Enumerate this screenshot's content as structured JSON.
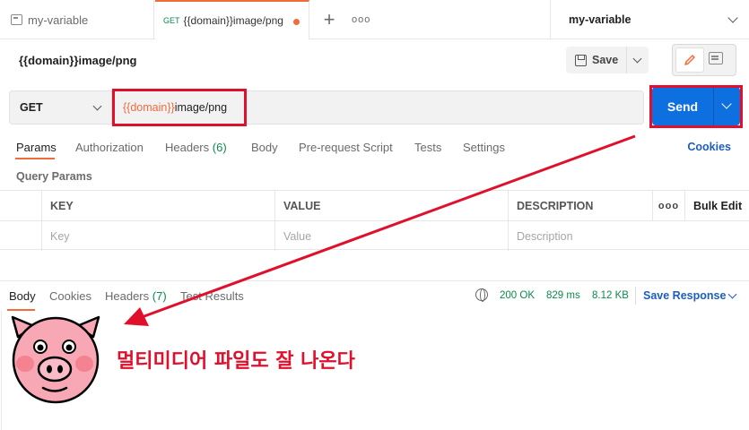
{
  "tabs": {
    "env_tab": {
      "label": "my-variable"
    },
    "active_tab": {
      "method": "GET",
      "label": "{{domain}}image/png"
    },
    "plus": "+",
    "more": "ooo"
  },
  "environment": {
    "selected": "my-variable"
  },
  "request": {
    "title": "{{domain}}image/png",
    "save_label": "Save",
    "method": "GET",
    "url_var": "{{domain}}",
    "url_path": "image/png",
    "send_label": "Send"
  },
  "request_tabs": {
    "params": "Params",
    "authorization": "Authorization",
    "headers": "Headers",
    "headers_count": "(6)",
    "body": "Body",
    "prerequest": "Pre-request Script",
    "tests": "Tests",
    "settings": "Settings",
    "cookies": "Cookies"
  },
  "query_params": {
    "title": "Query Params",
    "columns": [
      "KEY",
      "VALUE",
      "DESCRIPTION"
    ],
    "more": "ooo",
    "bulk_edit": "Bulk Edit",
    "placeholders": [
      "Key",
      "Value",
      "Description"
    ]
  },
  "response": {
    "tabs": {
      "body": "Body",
      "cookies": "Cookies",
      "headers": "Headers",
      "headers_count": "(7)",
      "test_results": "Test Results"
    },
    "status": "200 OK",
    "time": "829 ms",
    "size": "8.12 KB",
    "save_response": "Save Response"
  },
  "annotation": {
    "caption": "멀티미디어 파일도 잘 나온다",
    "color": "#e0102c"
  },
  "colors": {
    "accent": "#f26b3a",
    "send": "#0e6fe0",
    "link": "#1d5dbf",
    "ok": "#0b8a4b",
    "pig": "#f7a8b4"
  }
}
